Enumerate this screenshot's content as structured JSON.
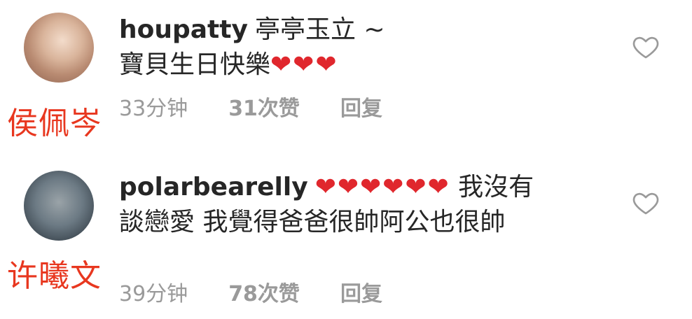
{
  "comments": [
    {
      "username": "houpatty",
      "text_line1": "亭亭玉立 ~",
      "text_line2": "寶貝生日快樂",
      "hearts_line2": "❤❤❤",
      "hearts_after_username": "",
      "time": "33分钟",
      "likes": "31次赞",
      "reply": "回复",
      "name_caption": "侯佩岑"
    },
    {
      "username": "polarbearelly",
      "hearts_after_username": "❤❤❤❤❤❤",
      "text_line1": "我沒有",
      "text_line2": "談戀愛 我覺得爸爸很帥阿公也很帥",
      "hearts_line2": "",
      "time": "39分钟",
      "likes": "78次赞",
      "reply": "回复",
      "name_caption": "许曦文"
    }
  ],
  "icons": {
    "like": "heart-outline-icon"
  },
  "colors": {
    "caption": "#e8371f",
    "heart": "#e0272d",
    "meta": "#9a9a9a",
    "text": "#262626"
  }
}
